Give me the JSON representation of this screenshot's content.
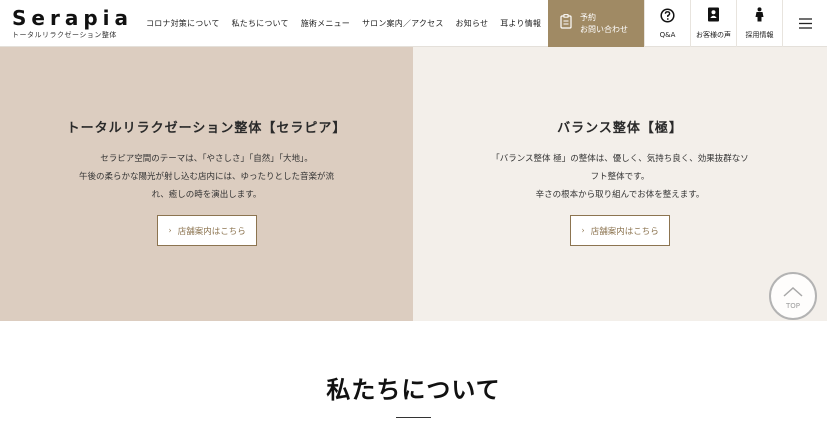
{
  "header": {
    "logo_name": "Serapia",
    "logo_sub": "トータルリラクゼーション整体",
    "nav": [
      "コロナ対策について",
      "私たちについて",
      "施術メニュー",
      "サロン案内／アクセス",
      "お知らせ",
      "耳より情報"
    ],
    "contact": {
      "line1": "予約",
      "line2": "お問い合わせ",
      "icon": "document-icon"
    },
    "icons": [
      {
        "label": "Q&A",
        "icon": "question-circle-icon"
      },
      {
        "label": "お客様の声",
        "icon": "person-book-icon"
      },
      {
        "label": "採用情報",
        "icon": "person-icon"
      }
    ],
    "menu_icon": "hamburger-icon",
    "accent_color": "#a08a64"
  },
  "panels": [
    {
      "title": "トータルリラクゼーション整体【セラピア】",
      "lines": [
        "セラピア空間のテーマは、「やさしさ」「自然」「大地」。",
        "午後の柔らかな陽光が射し込む店内には、ゆったりとした音楽が流",
        "れ、癒しの時を演出します。"
      ],
      "button": "店舗案内はこちら",
      "bg": "#dccdc0"
    },
    {
      "title": "バランス整体【極】",
      "lines": [
        "「バランス整体 極」の整体は、優しく、気持ち良く、効果抜群なソ",
        "フト整体です。",
        "辛さの根本から取り組んでお体を整えます。"
      ],
      "button": "店舗案内はこちら",
      "bg": "#f3efea"
    }
  ],
  "top_button": "TOP",
  "about": {
    "title": "私たちについて"
  }
}
